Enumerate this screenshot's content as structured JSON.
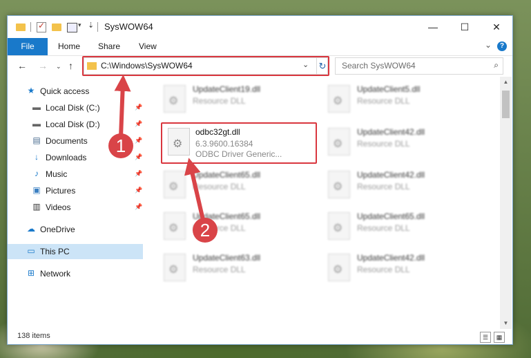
{
  "window": {
    "title": "SysWOW64"
  },
  "ribbon": {
    "tabs": [
      "File",
      "Home",
      "Share",
      "View"
    ],
    "help_label": "?"
  },
  "nav": {
    "address": "C:\\Windows\\SysWOW64",
    "search_placeholder": "Search SysWOW64"
  },
  "sidebar": {
    "items": [
      {
        "label": "Quick access",
        "icon": "star-icon"
      },
      {
        "label": "Local Disk (C:)",
        "icon": "drive-icon"
      },
      {
        "label": "Local Disk (D:)",
        "icon": "drive-icon"
      },
      {
        "label": "Documents",
        "icon": "documents-icon"
      },
      {
        "label": "Downloads",
        "icon": "download-arrow-icon"
      },
      {
        "label": "Music",
        "icon": "music-note-icon"
      },
      {
        "label": "Pictures",
        "icon": "pictures-icon"
      },
      {
        "label": "Videos",
        "icon": "film-icon"
      },
      {
        "label": "OneDrive",
        "icon": "cloud-icon"
      },
      {
        "label": "This PC",
        "icon": "computer-icon"
      },
      {
        "label": "Network",
        "icon": "network-icon"
      }
    ]
  },
  "files": [
    {
      "name": "UpdateClient19.dll",
      "type": "Resource DLL"
    },
    {
      "name": "UpdateClient5.dll",
      "type": "Resource DLL"
    },
    {
      "name": "odbc32gt.dll",
      "version": "6.3.9600.16384",
      "description": "ODBC Driver Generic..."
    },
    {
      "name": "UpdateClient42.dll",
      "type": "Resource DLL"
    },
    {
      "name": "UpdateClient65.dll",
      "type": "Resource DLL"
    },
    {
      "name": "UpdateClient42.dll",
      "type": "Resource DLL"
    },
    {
      "name": "UpdateClient65.dll",
      "type": "Resource DLL"
    },
    {
      "name": "UpdateClient65.dll",
      "type": "Resource DLL"
    },
    {
      "name": "UpdateClient63.dll",
      "type": "Resource DLL"
    },
    {
      "name": "UpdateClient42.dll",
      "type": "Resource DLL"
    }
  ],
  "status": {
    "item_count": "138 items"
  },
  "callouts": [
    "1",
    "2"
  ],
  "colors": {
    "accent": "#1979ca",
    "highlight": "#d9363e",
    "selected": "#cce4f7"
  }
}
